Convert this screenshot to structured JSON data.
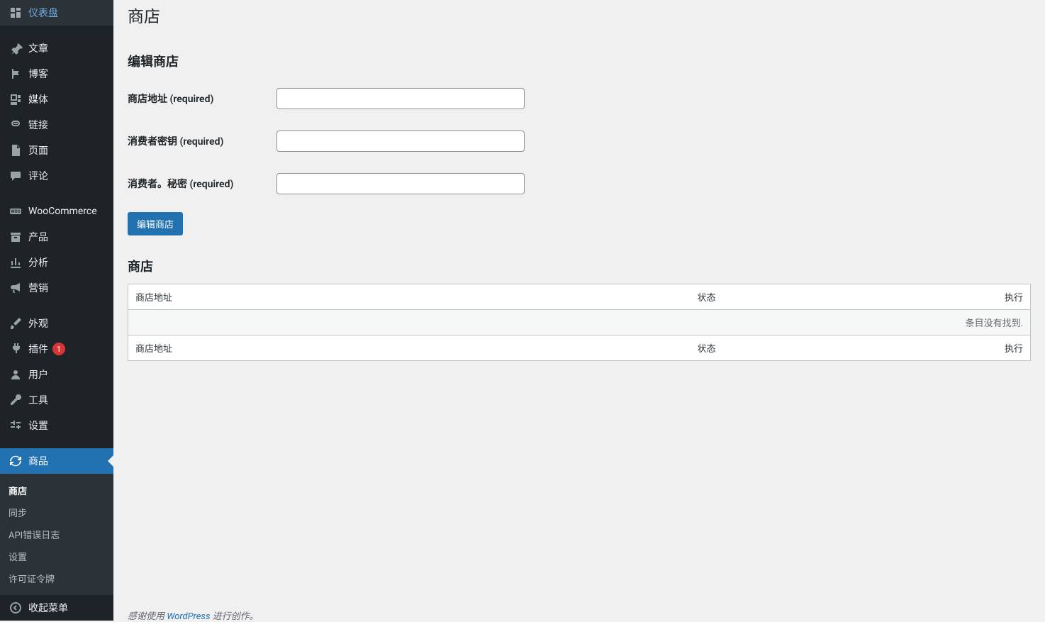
{
  "sidebar": {
    "items": [
      {
        "label": "仪表盘",
        "icon": "dashboard"
      },
      {
        "label": "文章",
        "icon": "pin"
      },
      {
        "label": "博客",
        "icon": "flag"
      },
      {
        "label": "媒体",
        "icon": "media"
      },
      {
        "label": "链接",
        "icon": "link"
      },
      {
        "label": "页面",
        "icon": "page"
      },
      {
        "label": "评论",
        "icon": "comment"
      },
      {
        "label": "WooCommerce",
        "icon": "woo"
      },
      {
        "label": "产品",
        "icon": "archive"
      },
      {
        "label": "分析",
        "icon": "chart"
      },
      {
        "label": "营销",
        "icon": "megaphone"
      },
      {
        "label": "外观",
        "icon": "brush"
      },
      {
        "label": "插件",
        "icon": "plug",
        "badge": "1"
      },
      {
        "label": "用户",
        "icon": "user"
      },
      {
        "label": "工具",
        "icon": "wrench"
      },
      {
        "label": "设置",
        "icon": "sliders"
      },
      {
        "label": "商品",
        "icon": "refresh",
        "active": true
      }
    ],
    "submenu": [
      {
        "label": "商店",
        "current": true
      },
      {
        "label": "同步"
      },
      {
        "label": "API错误日志"
      },
      {
        "label": "设置"
      },
      {
        "label": "许可证令牌"
      }
    ],
    "collapse": "收起菜单"
  },
  "page": {
    "title": "商店",
    "edit_heading": "编辑商店",
    "fields": {
      "store_url_label": "商店地址 (required)",
      "consumer_key_label": "消费者密钥 (required)",
      "consumer_secret_label": "消费者。秘密 (required)"
    },
    "submit_label": "编辑商店",
    "list_heading": "商店",
    "table": {
      "col_url": "商店地址",
      "col_status": "状态",
      "col_action": "执行",
      "empty": "条目没有找到."
    }
  },
  "footer": {
    "text_before": "感谢使用 ",
    "link": "WordPress",
    "text_after": " 进行创作。"
  }
}
